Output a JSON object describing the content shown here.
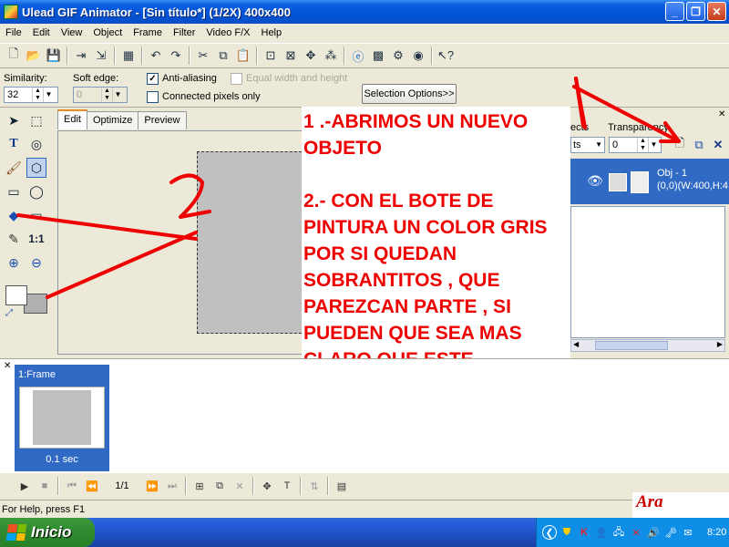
{
  "window": {
    "title": "Ulead GIF Animator - [Sin título*] (1/2X)  400x400",
    "controls": [
      "minimize",
      "maximize",
      "close"
    ]
  },
  "menubar": [
    "File",
    "Edit",
    "View",
    "Object",
    "Frame",
    "Filter",
    "Video F/X",
    "Help"
  ],
  "toolbar": {
    "icons": [
      "new-file-icon",
      "open-folder-icon",
      "save-icon",
      "add-image-icon",
      "export-icon",
      "colors-icon",
      "undo-icon",
      "redo-icon",
      "cut-icon",
      "copy-icon",
      "paste-icon",
      "crop-icon",
      "delete-icon",
      "transform-icon",
      "effects-icon",
      "browser-preview-icon",
      "optimize-icon",
      "settings-icon",
      "help-pointer-icon"
    ]
  },
  "options": {
    "similarity_label": "Similarity:",
    "similarity_value": "32",
    "soft_edge_label": "Soft edge:",
    "soft_edge_value": "0",
    "anti_aliasing_label": "Anti-aliasing",
    "anti_aliasing_checked": true,
    "equal_width_label": "Equal width and height",
    "connected_pixels_label": "Connected pixels only",
    "selection_options_label": "Selection Options>>"
  },
  "tools": [
    "pick-tool-icon",
    "marquee-tool-icon",
    "text-tool-icon",
    "lasso-tool-icon",
    "brush-tool-icon",
    "magic-wand-icon",
    "eraser-icon",
    "ellipse-icon",
    "paint-bucket-icon",
    "rectangle-icon",
    "eyedropper-icon",
    "actual-size-icon",
    "zoom-in-icon",
    "zoom-out-icon"
  ],
  "tool_text": {
    "actual_size": "1:1"
  },
  "colors": {
    "foreground": "#ffffff",
    "background": "#b0b0b0",
    "canvas_fill": "#c0c0c0",
    "annotation": "#ee0000",
    "selection": "#316ac5"
  },
  "editor": {
    "tabs": [
      "Edit",
      "Optimize",
      "Preview"
    ],
    "active_tab": "Edit"
  },
  "object_manager": {
    "header_partial": "ects",
    "transparency_label": "Transparency",
    "mode_value": "ts",
    "transparency_value": "0",
    "object_name": "Obj - 1",
    "object_info": "(0,0)(W:400,H:4"
  },
  "annotation": {
    "text": "1 .-ABRIMOS UN NUEVO OBJETO\n\n2.- CON EL BOTE DE PINTURA UN COLOR GRIS POR SI QUEDAN SOBRANTITOS , QUE PAREZCAN PARTE , SI PUEDEN QUE SEA MAS CLARO QUE ESTE",
    "handwritten_1": "1",
    "handwritten_2": "2"
  },
  "frames": {
    "frame_label": "1:Frame",
    "frame_delay": "0.1 sec"
  },
  "playback": {
    "counter": "1/1"
  },
  "status": {
    "help_text": "For Help, press F1",
    "watermark": "Ara"
  },
  "taskbar": {
    "start_label": "Inicio",
    "clock": "8:20"
  }
}
